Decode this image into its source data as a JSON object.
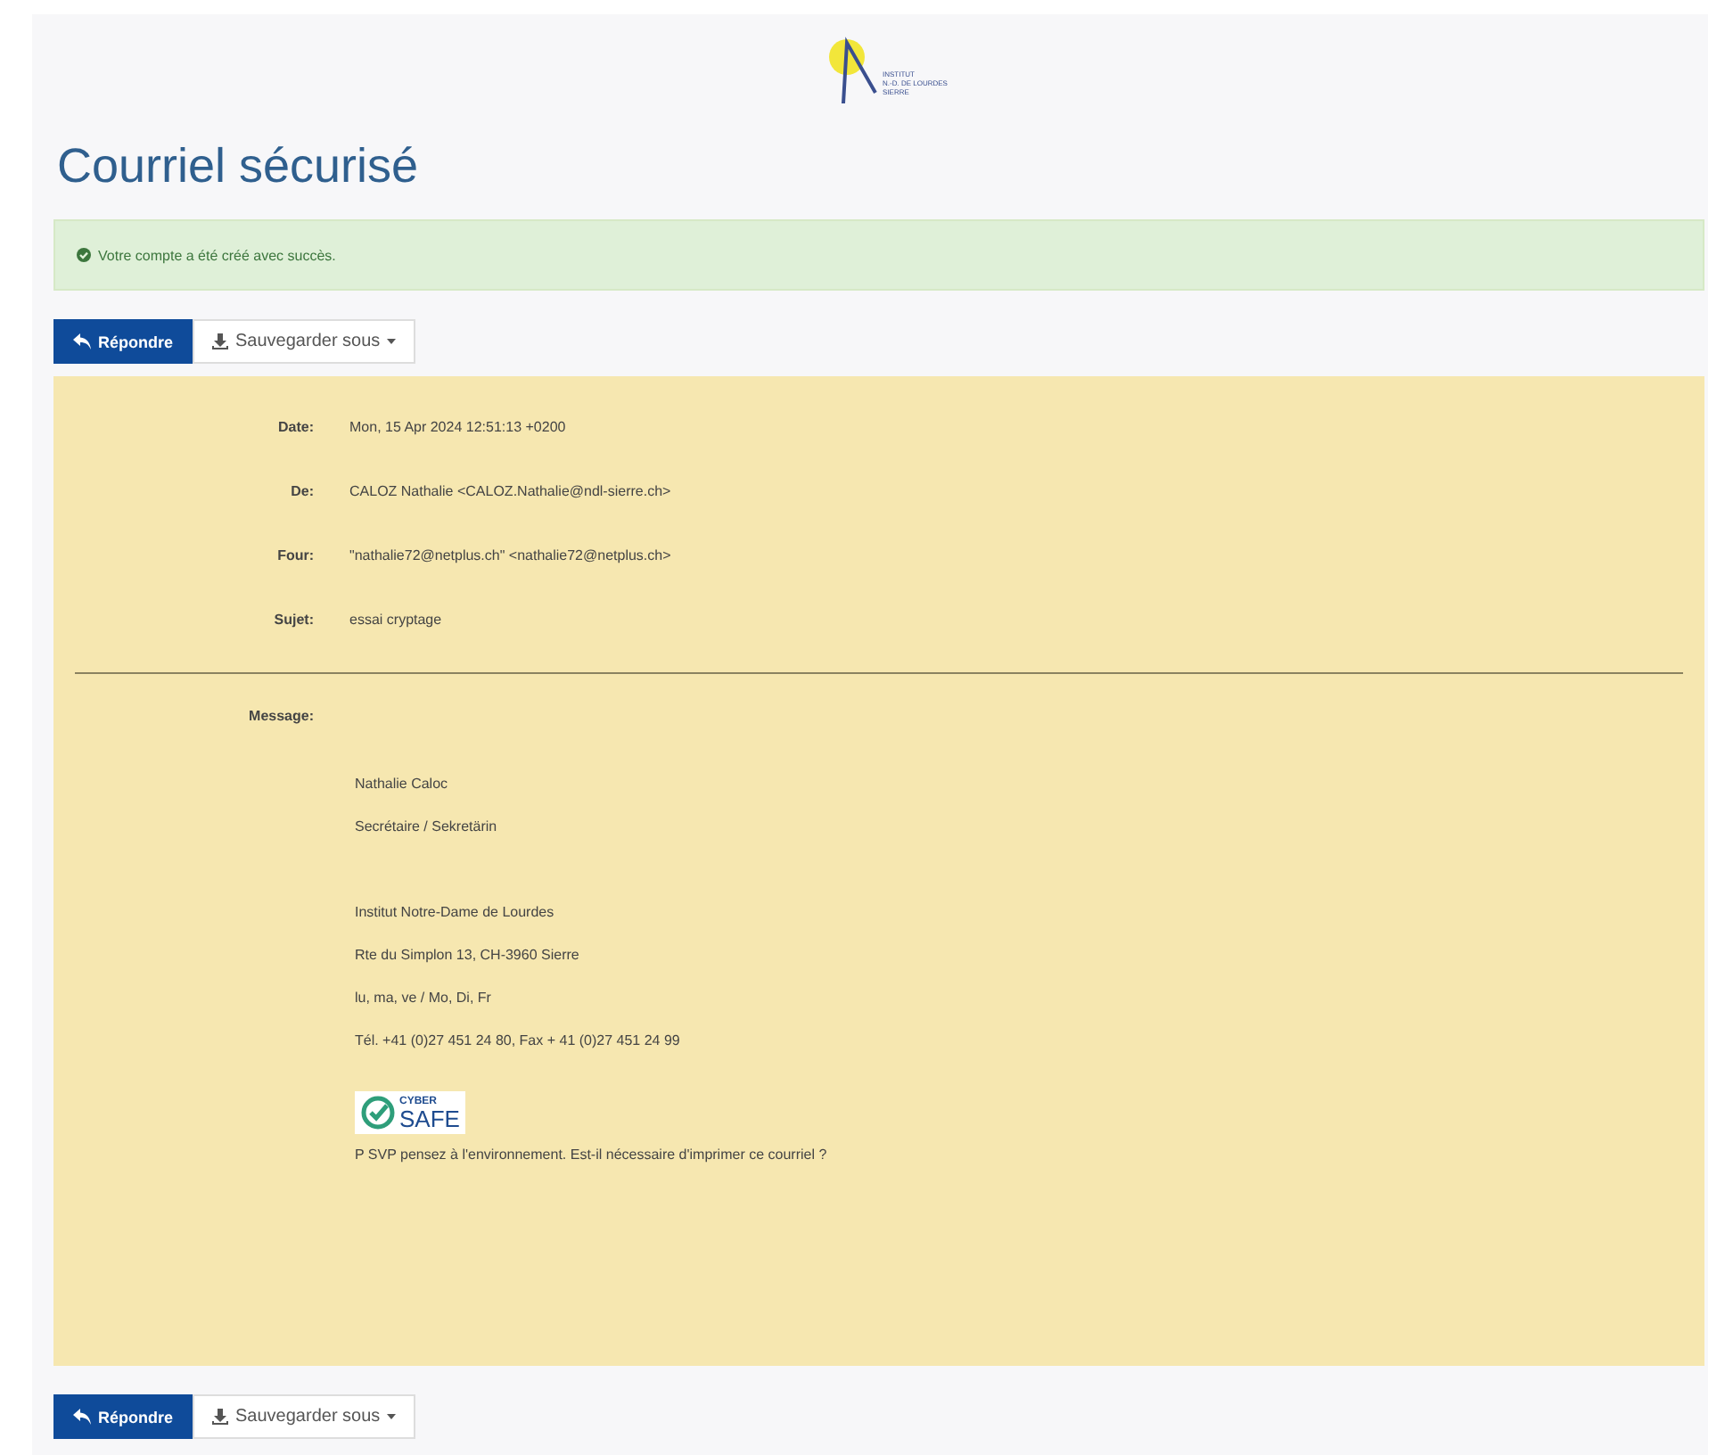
{
  "logo": {
    "lines": [
      "INSTITUT",
      "N.-D. DE LOURDES",
      "SIERRE"
    ]
  },
  "title": "Courriel sécurisé",
  "alert": {
    "text": "Votre compte a été créé avec succès."
  },
  "toolbar": {
    "reply": "Répondre",
    "save": "Sauvegarder sous"
  },
  "headers": [
    {
      "label": "Date:",
      "value": "Mon, 15 Apr 2024 12:51:13 +0200"
    },
    {
      "label": "De:",
      "value": "CALOZ Nathalie <CALOZ.Nathalie@ndl-sierre.ch>"
    },
    {
      "label": "Four:",
      "value": "\"nathalie72@netplus.ch\" <nathalie72@netplus.ch>"
    },
    {
      "label": "Sujet:",
      "value": "essai cryptage"
    }
  ],
  "message": {
    "label": "Message:",
    "blocks": [
      [
        "Nathalie Caloc",
        "Secrétaire / Sekretärin"
      ],
      [
        "Institut Notre-Dame de Lourdes",
        "Rte du Simplon 13, CH-3960 Sierre",
        "lu, ma, ve / Mo, Di, Fr",
        "Tél. +41 (0)27 451 24 80, Fax + 41 (0)27 451 24 99"
      ]
    ],
    "badge": {
      "top": "CYBER",
      "bottom": "SAFE"
    },
    "footer": "P SVP pensez à l'environnement. Est-il nécessaire d'imprimer ce courriel ?"
  },
  "bottom_toolbar": {
    "reply": "Répondre",
    "save": "Sauvegarder sous"
  }
}
